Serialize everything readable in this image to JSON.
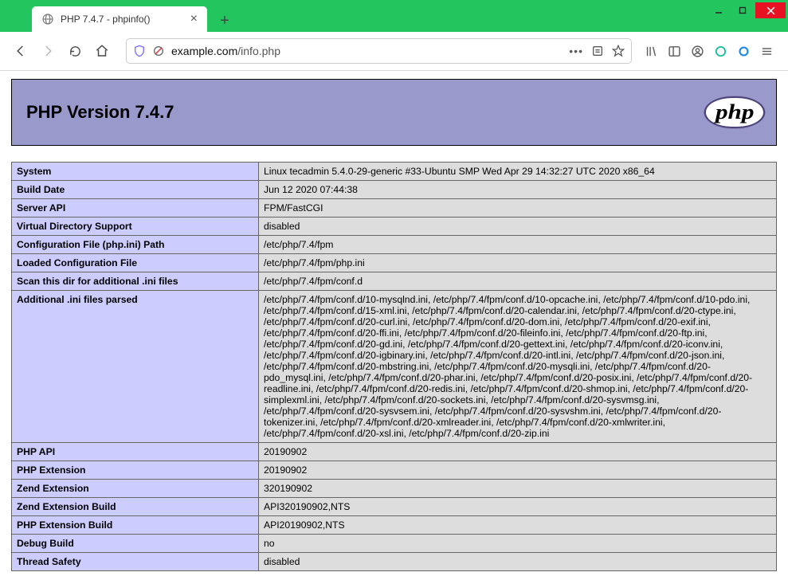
{
  "window": {
    "tab_title": "PHP 7.4.7 - phpinfo()",
    "url_prefix": "example.com",
    "url_path": "/info.php"
  },
  "php": {
    "header_title": "PHP Version 7.4.7",
    "logo_text": "php",
    "rows": [
      {
        "k": "System",
        "v": "Linux tecadmin 5.4.0-29-generic #33-Ubuntu SMP Wed Apr 29 14:32:27 UTC 2020 x86_64"
      },
      {
        "k": "Build Date",
        "v": "Jun 12 2020 07:44:38"
      },
      {
        "k": "Server API",
        "v": "FPM/FastCGI"
      },
      {
        "k": "Virtual Directory Support",
        "v": "disabled"
      },
      {
        "k": "Configuration File (php.ini) Path",
        "v": "/etc/php/7.4/fpm"
      },
      {
        "k": "Loaded Configuration File",
        "v": "/etc/php/7.4/fpm/php.ini"
      },
      {
        "k": "Scan this dir for additional .ini files",
        "v": "/etc/php/7.4/fpm/conf.d"
      },
      {
        "k": "Additional .ini files parsed",
        "v": "/etc/php/7.4/fpm/conf.d/10-mysqlnd.ini, /etc/php/7.4/fpm/conf.d/10-opcache.ini, /etc/php/7.4/fpm/conf.d/10-pdo.ini, /etc/php/7.4/fpm/conf.d/15-xml.ini, /etc/php/7.4/fpm/conf.d/20-calendar.ini, /etc/php/7.4/fpm/conf.d/20-ctype.ini, /etc/php/7.4/fpm/conf.d/20-curl.ini, /etc/php/7.4/fpm/conf.d/20-dom.ini, /etc/php/7.4/fpm/conf.d/20-exif.ini, /etc/php/7.4/fpm/conf.d/20-ffi.ini, /etc/php/7.4/fpm/conf.d/20-fileinfo.ini, /etc/php/7.4/fpm/conf.d/20-ftp.ini, /etc/php/7.4/fpm/conf.d/20-gd.ini, /etc/php/7.4/fpm/conf.d/20-gettext.ini, /etc/php/7.4/fpm/conf.d/20-iconv.ini, /etc/php/7.4/fpm/conf.d/20-igbinary.ini, /etc/php/7.4/fpm/conf.d/20-intl.ini, /etc/php/7.4/fpm/conf.d/20-json.ini, /etc/php/7.4/fpm/conf.d/20-mbstring.ini, /etc/php/7.4/fpm/conf.d/20-mysqli.ini, /etc/php/7.4/fpm/conf.d/20-pdo_mysql.ini, /etc/php/7.4/fpm/conf.d/20-phar.ini, /etc/php/7.4/fpm/conf.d/20-posix.ini, /etc/php/7.4/fpm/conf.d/20-readline.ini, /etc/php/7.4/fpm/conf.d/20-redis.ini, /etc/php/7.4/fpm/conf.d/20-shmop.ini, /etc/php/7.4/fpm/conf.d/20-simplexml.ini, /etc/php/7.4/fpm/conf.d/20-sockets.ini, /etc/php/7.4/fpm/conf.d/20-sysvmsg.ini, /etc/php/7.4/fpm/conf.d/20-sysvsem.ini, /etc/php/7.4/fpm/conf.d/20-sysvshm.ini, /etc/php/7.4/fpm/conf.d/20-tokenizer.ini, /etc/php/7.4/fpm/conf.d/20-xmlreader.ini, /etc/php/7.4/fpm/conf.d/20-xmlwriter.ini, /etc/php/7.4/fpm/conf.d/20-xsl.ini, /etc/php/7.4/fpm/conf.d/20-zip.ini"
      },
      {
        "k": "PHP API",
        "v": "20190902"
      },
      {
        "k": "PHP Extension",
        "v": "20190902"
      },
      {
        "k": "Zend Extension",
        "v": "320190902"
      },
      {
        "k": "Zend Extension Build",
        "v": "API320190902,NTS"
      },
      {
        "k": "PHP Extension Build",
        "v": "API20190902,NTS"
      },
      {
        "k": "Debug Build",
        "v": "no"
      },
      {
        "k": "Thread Safety",
        "v": "disabled"
      }
    ]
  }
}
